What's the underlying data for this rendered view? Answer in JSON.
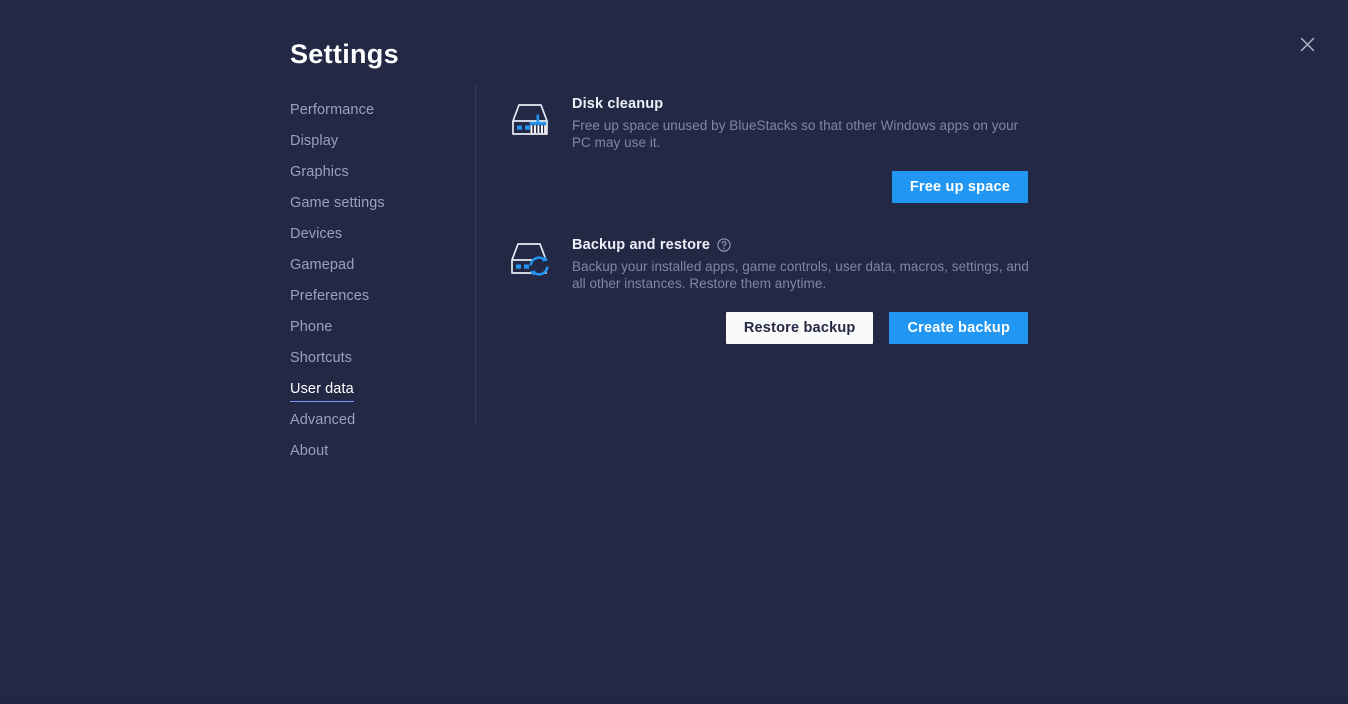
{
  "window": {
    "title": "Settings",
    "close_icon": "close-icon"
  },
  "sidebar": {
    "items": [
      {
        "label": "Performance",
        "active": false
      },
      {
        "label": "Display",
        "active": false
      },
      {
        "label": "Graphics",
        "active": false
      },
      {
        "label": "Game settings",
        "active": false
      },
      {
        "label": "Devices",
        "active": false
      },
      {
        "label": "Gamepad",
        "active": false
      },
      {
        "label": "Preferences",
        "active": false
      },
      {
        "label": "Phone",
        "active": false
      },
      {
        "label": "Shortcuts",
        "active": false
      },
      {
        "label": "User data",
        "active": true
      },
      {
        "label": "Advanced",
        "active": false
      },
      {
        "label": "About",
        "active": false
      }
    ]
  },
  "main": {
    "sections": [
      {
        "id": "disk-cleanup",
        "icon": "disk-cleanup-icon",
        "title": "Disk cleanup",
        "description": "Free up space unused by BlueStacks so that other Windows apps on your PC may use it.",
        "has_help": false,
        "buttons": [
          {
            "label": "Free up space",
            "style": "primary"
          }
        ]
      },
      {
        "id": "backup-and-restore",
        "icon": "backup-restore-icon",
        "title": "Backup and restore",
        "description": "Backup your installed apps, game controls, user data, macros, settings, and all other instances. Restore them anytime.",
        "has_help": true,
        "help_icon": "help-circle-icon",
        "buttons": [
          {
            "label": "Restore backup",
            "style": "secondary"
          },
          {
            "label": "Create backup",
            "style": "primary"
          }
        ]
      }
    ]
  },
  "colors": {
    "background": "#232845",
    "accent_blue": "#2196f3",
    "icon_blue": "#2196f3",
    "sidebar_text": "#9aa1bd",
    "active_text": "#ffffff",
    "underline": "#7a93ff",
    "description_text": "#7e87a8",
    "secondary_button_bg": "#fafafa",
    "divider": "#353c60"
  }
}
